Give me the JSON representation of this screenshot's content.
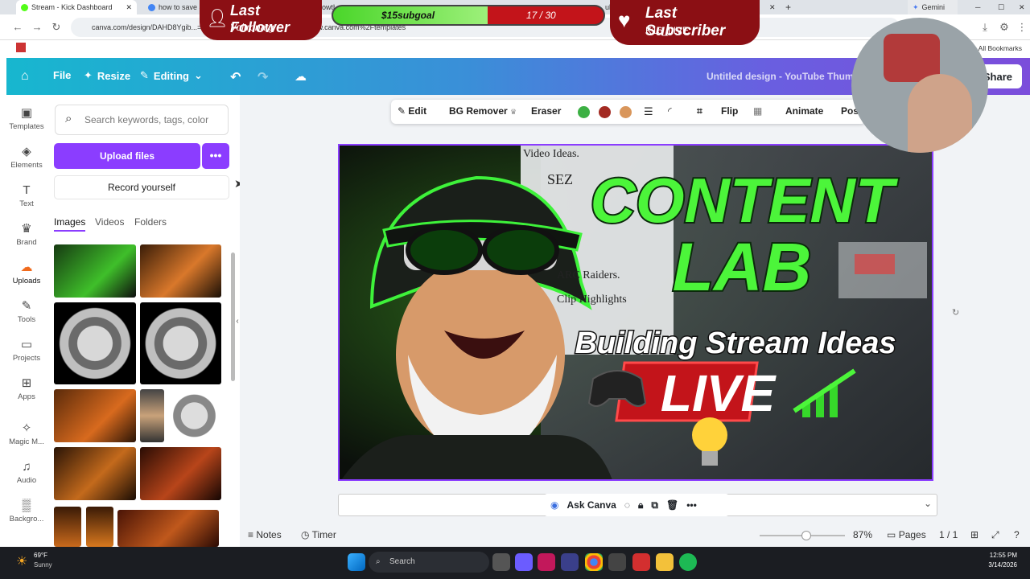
{
  "browser": {
    "tabs": [
      {
        "label": "Stream - Kick Dashboard"
      },
      {
        "label": "how to save a"
      },
      {
        "label": "owth"
      },
      {
        "label": "ube"
      },
      {
        "label": "Gemini"
      }
    ],
    "url": "canva.com/design/DAHD8Ygib...=e30&referrer=https%3A%2F%2Fwww.canva.com%2Ftemplates",
    "bookmarks_label": "All Bookmarks"
  },
  "overlay": {
    "follower_title": "Last Follower",
    "follower_name": "Voltronatg",
    "goal_label": "$15subgoal",
    "goal_count": "17 / 30",
    "goal_progress": 0.57,
    "subscriber_title": "Last Subscriber",
    "subscriber_name": "K16_LIVE"
  },
  "canva": {
    "file_label": "File",
    "resize_label": "Resize",
    "editing_label": "Editing",
    "doc_title": "Untitled design - YouTube Thum",
    "share_label": "Share"
  },
  "rail": [
    {
      "label": "Templates",
      "icon": "templates-icon"
    },
    {
      "label": "Elements",
      "icon": "elements-icon"
    },
    {
      "label": "Text",
      "icon": "text-icon"
    },
    {
      "label": "Brand",
      "icon": "brand-icon"
    },
    {
      "label": "Uploads",
      "icon": "uploads-icon"
    },
    {
      "label": "Tools",
      "icon": "tools-icon"
    },
    {
      "label": "Projects",
      "icon": "projects-icon"
    },
    {
      "label": "Apps",
      "icon": "apps-icon"
    },
    {
      "label": "Magic M...",
      "icon": "magic-media-icon"
    },
    {
      "label": "Audio",
      "icon": "audio-icon"
    },
    {
      "label": "Backgro...",
      "icon": "background-icon"
    }
  ],
  "panel": {
    "search_placeholder": "Search keywords, tags, color",
    "upload_label": "Upload files",
    "record_label": "Record yourself",
    "tabs": [
      "Images",
      "Videos",
      "Folders"
    ]
  },
  "toolbar": {
    "edit": "Edit",
    "bg_remover": "BG Remover",
    "eraser": "Eraser",
    "colors": [
      "#3cb043",
      "#a32a22",
      "#d9965b"
    ],
    "flip": "Flip",
    "animate": "Animate",
    "position": "Pos"
  },
  "design": {
    "title_top": "CONTENT",
    "title_bottom": "LAB",
    "subtitle": "Building Stream Ideas",
    "live": "LIVE",
    "notes": [
      "Video Ideas.",
      "SEZ",
      "ARC Raiders.",
      "Clip Highlights"
    ]
  },
  "ask": {
    "label": "Ask Canva"
  },
  "footer": {
    "notes": "Notes",
    "timer": "Timer",
    "zoom": "87%",
    "pages": "Pages",
    "page_count": "1 / 1"
  },
  "taskbar": {
    "weather_temp": "69°F",
    "weather_desc": "Sunny",
    "search": "Search",
    "time": "12:55 PM",
    "date": "3/14/2026"
  }
}
